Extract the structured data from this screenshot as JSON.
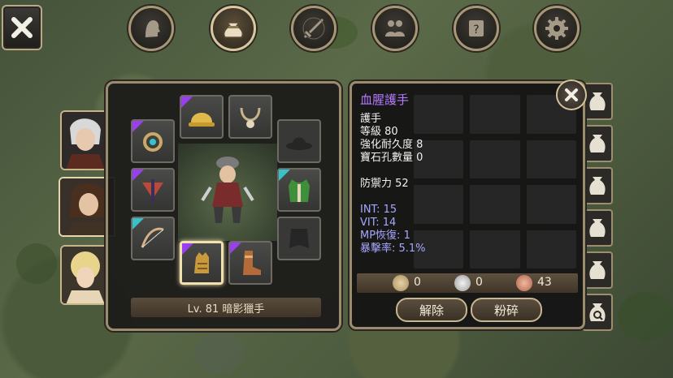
{
  "app": {
    "screen": "equipment"
  },
  "top_tabs": [
    {
      "icon": "character-head-icon"
    },
    {
      "icon": "bag-icon"
    },
    {
      "icon": "skill-sword-icon"
    },
    {
      "icon": "party-icon"
    },
    {
      "icon": "quest-scroll-icon"
    },
    {
      "icon": "settings-gear-icon"
    }
  ],
  "equip_panel": {
    "selected_item_label": "Lv. 81 暗影獵手"
  },
  "item_detail": {
    "title": "血腥護手",
    "type": "護手",
    "level": "等級 80",
    "durability": "強化耐久度 8",
    "gem_slots": "寶石孔數量 0",
    "defense": "防禦力 52",
    "int": "INT: 15",
    "vit": "VIT: 14",
    "mp_recovery": "MP恢復: 1",
    "crit_rate": "暴擊率: 5.1%"
  },
  "currency": {
    "gold": "0",
    "silver": "0",
    "copper": "43"
  },
  "buttons": {
    "unequip": "解除",
    "shatter": "粉碎"
  },
  "colors": {
    "epic": "#9a3ff0",
    "rare": "#38c1c8",
    "stat_blue": "#a7a7ff",
    "title_purple": "#b579ff"
  }
}
